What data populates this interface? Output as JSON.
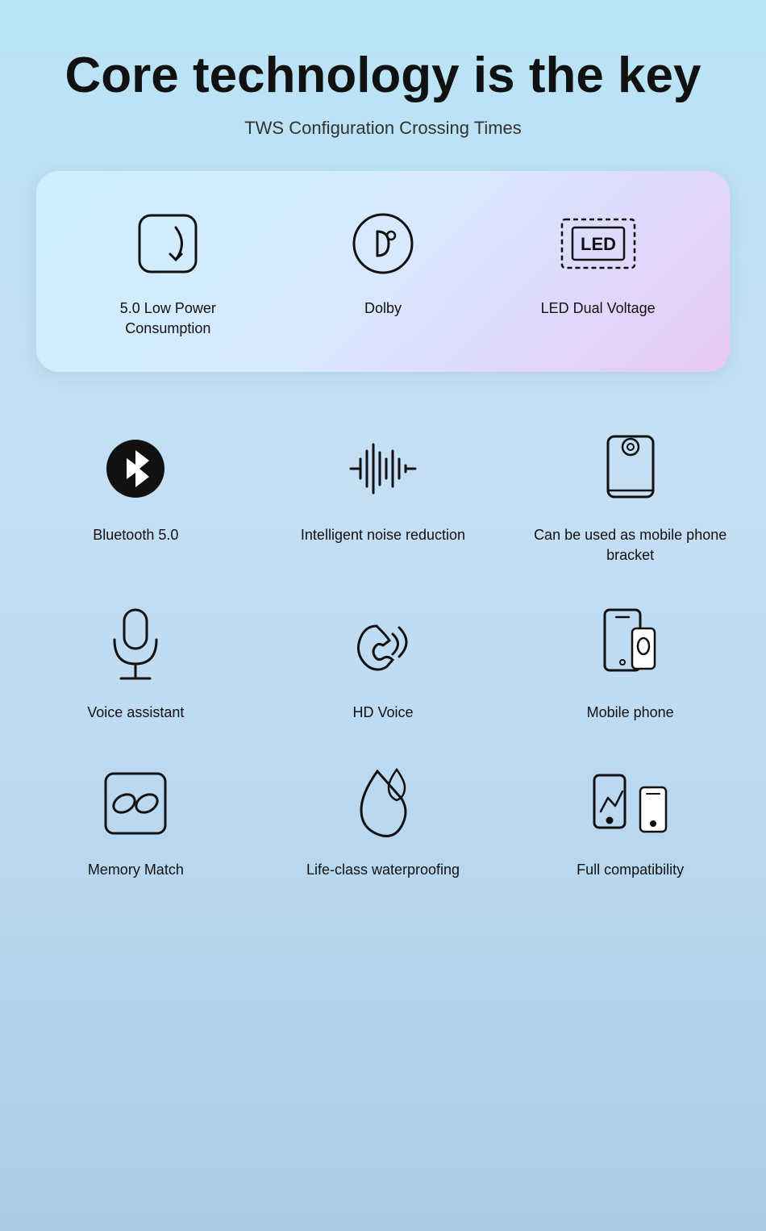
{
  "page": {
    "title": "Core technology is the key",
    "subtitle": "TWS Configuration Crossing Times"
  },
  "card_features": [
    {
      "id": "low-power",
      "label": "5.0 Low Power Consumption"
    },
    {
      "id": "dolby",
      "label": "Dolby"
    },
    {
      "id": "led",
      "label": "LED Dual Voltage"
    }
  ],
  "features": [
    {
      "id": "bluetooth",
      "label": "Bluetooth 5.0"
    },
    {
      "id": "noise-reduction",
      "label": "Intelligent noise reduction"
    },
    {
      "id": "phone-bracket",
      "label": "Can be used as mobile phone bracket"
    },
    {
      "id": "voice-assistant",
      "label": "Voice assistant"
    },
    {
      "id": "hd-voice",
      "label": "HD Voice"
    },
    {
      "id": "mobile-phone",
      "label": "Mobile phone"
    },
    {
      "id": "memory-match",
      "label": "Memory Match"
    },
    {
      "id": "waterproofing",
      "label": "Life-class waterproofing"
    },
    {
      "id": "compatibility",
      "label": "Full compatibility"
    }
  ]
}
